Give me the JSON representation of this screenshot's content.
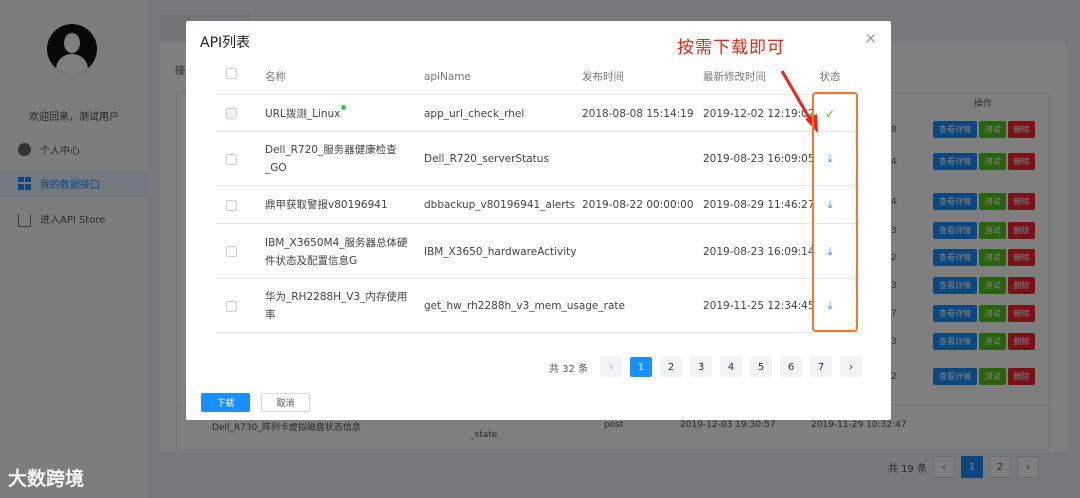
{
  "sidebar": {
    "welcome": "欢迎回来，测试用户",
    "items": [
      {
        "label": "个人中心",
        "icon": "user-icon"
      },
      {
        "label": "我的数据接口",
        "icon": "grid-icon"
      },
      {
        "label": "进入API Store",
        "icon": "home-icon"
      }
    ]
  },
  "background": {
    "partial_label": "接",
    "op_header": "操作",
    "rows": [
      {
        "num": "8"
      },
      {
        "num": "4"
      },
      {
        "num": "4"
      },
      {
        "num": "3"
      },
      {
        "num": "2"
      },
      {
        "num": "3"
      },
      {
        "num": "7"
      },
      {
        "num": "3"
      },
      {
        "num": "2"
      }
    ],
    "row_buttons": {
      "detail": "查看详情",
      "test": "测试",
      "delete": "删除"
    },
    "last_row": {
      "name": "Dell_R730_阵列卡虚拟磁盘状态信息",
      "api": "_state",
      "method": "post",
      "published": "2019-12-03 19:30:57",
      "modified": "2019-11-29 10:32:47"
    },
    "pager": {
      "total": "共 19 条",
      "pages": [
        "1",
        "2"
      ],
      "prev": "‹",
      "next": "›"
    }
  },
  "modal": {
    "title": "API列表",
    "close": "×",
    "annotation": "按需下载即可",
    "columns": {
      "name": "名称",
      "api": "apiName",
      "published": "发布时间",
      "modified": "最新修改时间",
      "status": "状态"
    },
    "rows": [
      {
        "name": "URL拨测_Linux",
        "api": "app_url_check_rhel",
        "published": "2018-08-08 15:14:19",
        "modified": "2019-12-02 12:19:02",
        "status": "✓"
      },
      {
        "name": "Dell_R720_服务器健康检查_GO",
        "api": "Dell_R720_serverStatus",
        "published": "",
        "modified": "2019-08-23 16:09:05",
        "status": "⤓"
      },
      {
        "name": "鼎甲获取警报v80196941",
        "api": "dbbackup_v80196941_alerts",
        "published": "2019-08-22 00:00:00",
        "modified": "2019-08-29 11:46:27",
        "status": "⤓"
      },
      {
        "name": "IBM_X3650M4_服务器总体硬件状态及配置信息G",
        "api": "IBM_X3650_hardwareActivity",
        "published": "",
        "modified": "2019-08-23 16:09:14",
        "status": "⤓"
      },
      {
        "name": "华为_RH2288H_V3_内存使用率",
        "api": "get_hw_rh2288h_v3_mem_usage_rate",
        "published": "",
        "modified": "2019-11-25 12:34:45",
        "status": "⤓"
      }
    ],
    "pager": {
      "total": "共 32 条",
      "prev": "‹",
      "next": "›",
      "pages": [
        "1",
        "2",
        "3",
        "4",
        "5",
        "6",
        "7"
      ]
    },
    "download_button": "下载",
    "cancel_button": "取消"
  },
  "watermark": "大数跨境",
  "colors": {
    "primary": "#1890ff",
    "success": "#52c41a",
    "danger": "#f5222d",
    "annotation": "#e8271a"
  }
}
